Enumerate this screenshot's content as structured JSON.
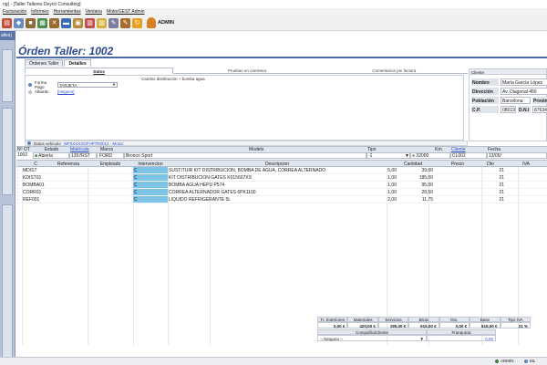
{
  "window": {
    "title": "ng) - [Taller Talleres Deyco Consulting]"
  },
  "menu": {
    "items": [
      "Facturación",
      "Informes",
      "Herramientas",
      "Ventana",
      "MotorGEST Admin"
    ]
  },
  "toolbar": {
    "icons": [
      "agenda-icon",
      "car-icon",
      "vehicle-icon",
      "print-icon",
      "tools-icon",
      "truck-icon",
      "box-icon",
      "calendar-icon",
      "document-icon",
      "edit-icon",
      "edit2-icon",
      "refresh-icon",
      "user-icon"
    ],
    "user": "ADMIN"
  },
  "left_panel": {
    "tab_label": "alles)"
  },
  "header": {
    "title": "Órden Taller: 1002"
  },
  "tabs": [
    {
      "label": "Órdenes Taller"
    },
    {
      "label": "Detalles"
    }
  ],
  "subtabs": [
    {
      "label": "Datos"
    },
    {
      "label": "Pruebas en carretera"
    },
    {
      "label": "Comentarios pie factura"
    }
  ],
  "datos": {
    "forma_pago_label": "Forma Pago",
    "forma_pago_value": "TARJETA",
    "albaran_label": "Albarán",
    "albaran_value": "[ninguno]",
    "notes": "Cambio distribución + bomba agua",
    "vehiculo_label": "Datos vehículo",
    "vehiculo_value": "WF0XXXXGFHP7R0012 - Motor:"
  },
  "cliente": {
    "header": "Cliente",
    "nombre_label": "Nombre",
    "nombre": "María García López",
    "direccion_label": "Dirección",
    "direccion": "Av. Diagonal 456",
    "poblacion_label": "Población",
    "poblacion": "Barcelona",
    "provincia_label": "Provin",
    "cp_label": "C.P.",
    "cp": "08019",
    "dni_label": "D.N.I",
    "dni": "87634321"
  },
  "ot": {
    "headers": [
      "Nº OT",
      "Estado",
      "Matrícula",
      "Marca",
      "Modelo",
      "Tipo",
      "Km.",
      "Cliente",
      "Fecha"
    ],
    "values": [
      "1002",
      "Abierta",
      "1357RST",
      "FORD",
      "Bronco Sport",
      "-1",
      "32000",
      "CL002",
      "13/05/"
    ]
  },
  "lines": {
    "headers": [
      "C",
      "Referencia",
      "Empleado",
      "Intervencion",
      "Descripcion",
      "Cantidad",
      "Precio",
      "Dto",
      "IVA"
    ],
    "rows": [
      {
        "ref": "MDIST",
        "emp": "",
        "int": "C",
        "desc": "SUSTITUIR KIT DISTRIBUCION, BOMBA DE AGUA, CORREA ALTERNADO",
        "cant": "5,00",
        "precio": "39,00",
        "dto": "",
        "iva": "21"
      },
      {
        "ref": "KDIST01",
        "emp": "",
        "int": "C",
        "desc": "KIT DISTRIBUCION GATES K015607XS",
        "cant": "1,00",
        "precio": "185,00",
        "dto": "",
        "iva": "21"
      },
      {
        "ref": "BOMBA01",
        "emp": "",
        "int": "C",
        "desc": "BOMBA AGUA HEPU P574",
        "cant": "1,00",
        "precio": "95,00",
        "dto": "",
        "iva": "21"
      },
      {
        "ref": "CORR01",
        "emp": "",
        "int": "C",
        "desc": "CORREA ALTERNADOR GATES 6PK1100",
        "cant": "1,00",
        "precio": "28,50",
        "dto": "",
        "iva": "21"
      },
      {
        "ref": "REF001",
        "emp": "",
        "int": "C",
        "desc": "LIQUIDO REFRIGERANTE 5L",
        "cant": "2,00",
        "precio": "11,75",
        "dto": "",
        "iva": "21"
      }
    ]
  },
  "totals": {
    "headers": [
      "Tr. Exteriores",
      "Materiales",
      "Servicios",
      "Bruto",
      "Dto.",
      "Base",
      "Tipo IVA"
    ],
    "values": [
      "0,00 €",
      "420,00 €",
      "195,00 €",
      "615,00 €",
      "0,00 €",
      "615,00 €",
      "21 %"
    ],
    "company_label": "Compañía/Cliente",
    "franquicia_label": "Franquicia",
    "company_value": "-- Ninguno --",
    "franquicia_value": "0,00"
  },
  "status": {
    "user": "ADMIN",
    "extra": "ML"
  },
  "colors": {
    "accent": "#2a4a8c",
    "intervention": "#7dc4e8",
    "header_bg": "#dfe5ef"
  }
}
